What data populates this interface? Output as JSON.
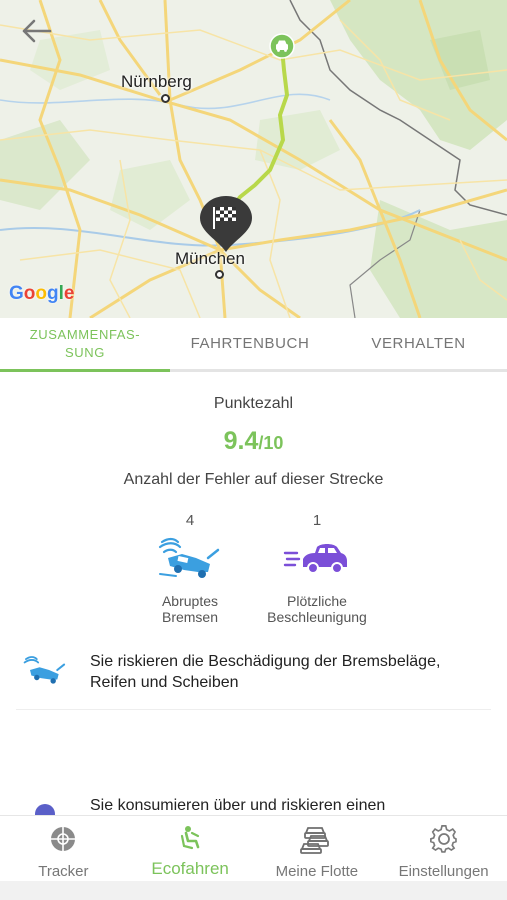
{
  "map": {
    "cities": [
      {
        "name": "Nürnberg"
      },
      {
        "name": "München"
      }
    ],
    "attribution": "Google",
    "colors": {
      "route": "#b8d84a",
      "start_marker": "#7cc35b",
      "finish_marker": "#333333"
    }
  },
  "icons": {
    "back": "arrow-left-icon",
    "start": "car-marker-icon",
    "finish": "checkered-flag-icon"
  },
  "tabs": [
    {
      "label": "ZUSAMMENFAS-SUNG",
      "line1": "ZUSAMMENFAS-",
      "line2": "SUNG",
      "active": true
    },
    {
      "label": "FAHRTENBUCH",
      "active": false
    },
    {
      "label": "VERHALTEN",
      "active": false
    }
  ],
  "summary": {
    "score_title": "Punktezahl",
    "score_value": "9.4",
    "score_max": "/10",
    "errors_title": "Anzahl der Fehler auf dieser Strecke",
    "metrics": [
      {
        "count": "4",
        "label_line1": "Abruptes",
        "label_line2": "Bremsen",
        "icon": "braking-icon"
      },
      {
        "count": "1",
        "label_line1": "Plötzliche",
        "label_line2": "Beschleunigung",
        "icon": "acceleration-icon"
      }
    ],
    "notices": [
      {
        "text": "Sie riskieren die Beschädigung der Bremsbeläge, Reifen und Scheiben",
        "icon": "braking-icon"
      },
      {
        "text": "Sie konsumieren über und riskieren einen",
        "icon": "fuel-icon"
      }
    ]
  },
  "nav": [
    {
      "label": "Tracker",
      "icon": "tracker-icon",
      "active": false
    },
    {
      "label": "Ecofahren",
      "icon": "eco-driver-icon",
      "active": true
    },
    {
      "label": "Meine Flotte",
      "icon": "fleet-icon",
      "active": false
    },
    {
      "label": "Einstellungen",
      "icon": "gear-icon",
      "active": false
    }
  ],
  "colors": {
    "accent": "#7cc35b",
    "icon_blue": "#3b9fe0",
    "icon_purple": "#7b4fd8"
  }
}
